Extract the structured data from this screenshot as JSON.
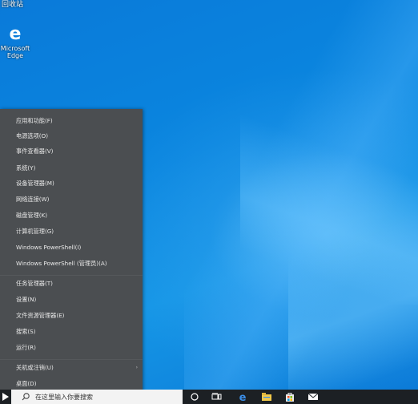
{
  "desktop": {
    "top_text": "回收站",
    "icons": [
      {
        "label": "Microsoft\nEdge",
        "icon": "edge-icon"
      }
    ]
  },
  "winx_menu": {
    "items": [
      {
        "label": "应用和功能(F)"
      },
      {
        "label": "电源选项(O)"
      },
      {
        "label": "事件查看器(V)"
      },
      {
        "label": "系统(Y)"
      },
      {
        "label": "设备管理器(M)"
      },
      {
        "label": "网络连接(W)"
      },
      {
        "label": "磁盘管理(K)"
      },
      {
        "label": "计算机管理(G)"
      },
      {
        "label": "Windows PowerShell(I)"
      },
      {
        "label": "Windows PowerShell (管理员)(A)"
      },
      {
        "label": "任务管理器(T)"
      },
      {
        "label": "设置(N)"
      },
      {
        "label": "文件资源管理器(E)"
      },
      {
        "label": "搜索(S)"
      },
      {
        "label": "运行(R)"
      },
      {
        "label": "关机或注销(U)"
      },
      {
        "label": "桌面(D)"
      }
    ],
    "submenu_arrow": "›"
  },
  "taskbar": {
    "search_placeholder": "在这里输入你要搜索的内容",
    "search_text": "在这里输入你要搜索",
    "icons": [
      "start-icon",
      "cortana-icon",
      "task-view-icon",
      "edge-icon",
      "explorer-icon",
      "store-icon",
      "mail-icon"
    ]
  },
  "colors": {
    "menu_bg": "#4b4e51",
    "taskbar_bg": "#1c2024",
    "desktop_bg": "#0a86df"
  }
}
